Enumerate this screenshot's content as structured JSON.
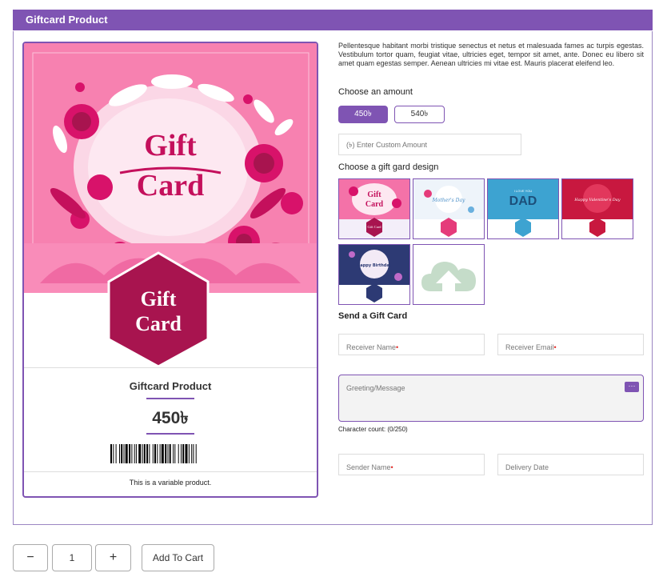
{
  "header": {
    "title": "Giftcard Product"
  },
  "preview": {
    "art_text_1": "Gift",
    "art_text_2": "Card",
    "badge_text_1": "Gift",
    "badge_text_2": "Card",
    "product_name": "Giftcard Product",
    "price": "450৳",
    "note": "This is a variable product."
  },
  "description": "Pellentesque habitant morbi tristique senectus et netus et malesuada fames ac turpis egestas. Vestibulum tortor quam, feugiat vitae, ultricies eget, tempor sit amet, ante. Donec eu libero sit amet quam egestas semper. Aenean ultricies mi vitae est. Mauris placerat eleifend leo.",
  "amount": {
    "label": "Choose an amount",
    "options": [
      "450৳",
      "540৳"
    ],
    "selected": "450৳",
    "custom_placeholder": "(৳) Enter Custom Amount"
  },
  "design": {
    "label": "Choose a gift gard design",
    "thumbs": [
      {
        "name": "Gift Card",
        "color": "#f472a8"
      },
      {
        "name": "Mother's Day",
        "color": "#e9f1f8"
      },
      {
        "name": "I Love You DAD",
        "color": "#3a9ccc"
      },
      {
        "name": "Happy Valentine's Day",
        "color": "#c0183a"
      },
      {
        "name": "Happy Birthday",
        "color": "#2d3a74"
      },
      {
        "name": "upload",
        "color": "#ffffff"
      }
    ],
    "thumb_labels": {
      "t1a": "Gift",
      "t1b": "Card",
      "t1badge": "Gift Card",
      "t2": "Mother's Day",
      "t3a": "I LOVE YOU",
      "t3b": "DAD",
      "t4": "Happy Valentine's Day",
      "t5": "Happy Birthday"
    }
  },
  "send": {
    "label": "Send a Gift Card",
    "receiver_name": "Receiver Name",
    "receiver_email": "Receiver Email",
    "greeting": "Greeting/Message",
    "emoji_btn": "···",
    "char_count": "Character count: (0/250)",
    "sender_name": "Sender Name",
    "delivery_date": "Delivery Date"
  },
  "cart": {
    "minus": "−",
    "qty": "1",
    "plus": "+",
    "add_label": "Add To Cart"
  },
  "colors": {
    "accent": "#7f54b3",
    "pink": "#f472a8",
    "magenta": "#a8144f"
  }
}
